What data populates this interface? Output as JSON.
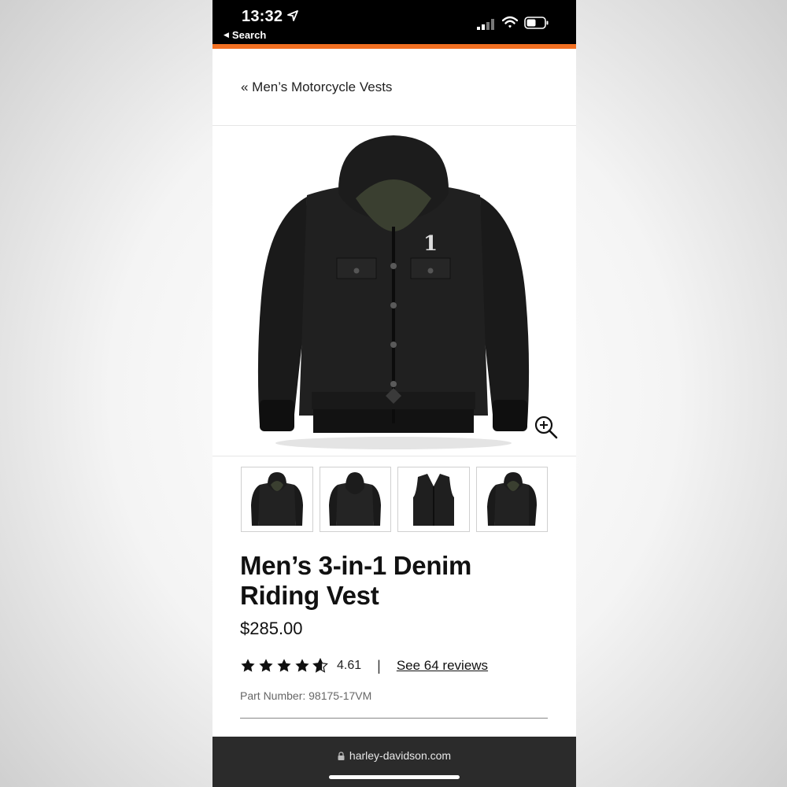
{
  "status": {
    "time": "13:32",
    "back_label": "Search"
  },
  "nav": {
    "breadcrumb": "« Men’s Motorcycle Vests"
  },
  "product": {
    "title": "Men’s 3-in-1 Denim Riding Vest",
    "price": "$285.00",
    "rating": 4.61,
    "rating_label": "4.61",
    "separator": "|",
    "reviews_link": "See 64 reviews",
    "part_number": "Part Number: 98175-17VM"
  },
  "thumbnails": [
    {
      "name": "thumbnail-front-hooded-jacket"
    },
    {
      "name": "thumbnail-back-hooded-jacket"
    },
    {
      "name": "thumbnail-vest"
    },
    {
      "name": "thumbnail-angle-hooded-jacket"
    }
  ],
  "browser": {
    "url": "harley-davidson.com"
  },
  "colors": {
    "accent": "#f26f21",
    "text": "#111111",
    "urlbar": "#2b2b2b"
  }
}
